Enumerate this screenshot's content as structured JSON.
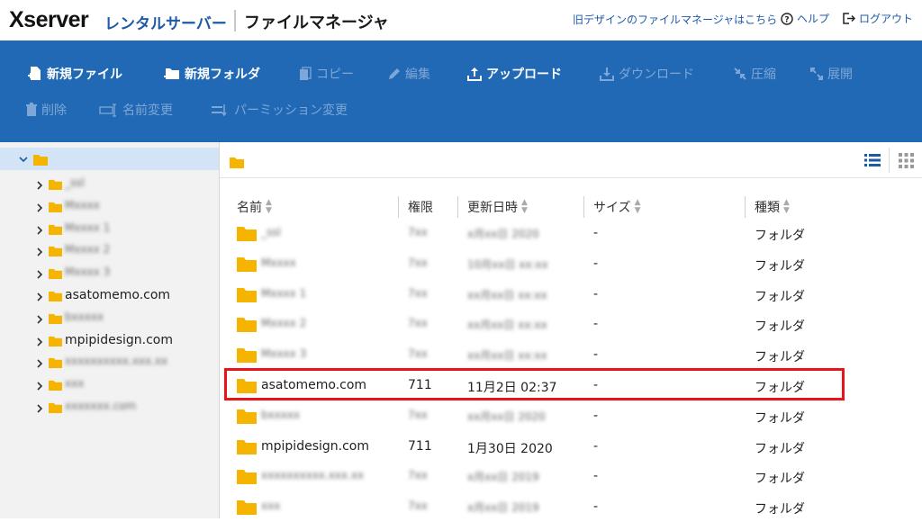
{
  "header": {
    "logo_main": "Xserver",
    "logo_sub": "レンタルサーバー",
    "title": "ファイルマネージャ",
    "old_design_link": "旧デザインのファイルマネージャはこちら",
    "help_label": "ヘルプ",
    "logout_label": "ログアウト"
  },
  "toolbar": {
    "new_file": "新規ファイル",
    "new_folder": "新規フォルダ",
    "copy": "コピー",
    "edit": "編集",
    "upload": "アップロード",
    "download": "ダウンロード",
    "compress": "圧縮",
    "extract": "展開",
    "delete": "削除",
    "rename": "名前変更",
    "permission": "パーミッション変更"
  },
  "sidebar": {
    "items": [
      {
        "label": "_ssl",
        "blurred": true
      },
      {
        "label": "Mxxxx",
        "blurred": true
      },
      {
        "label": "Mxxxx 1",
        "blurred": true
      },
      {
        "label": "Mxxxx 2",
        "blurred": true
      },
      {
        "label": "Mxxxx 3",
        "blurred": true
      },
      {
        "label": "asatomemo.com",
        "blurred": false
      },
      {
        "label": "bxxxxx",
        "blurred": true
      },
      {
        "label": "mpipidesign.com",
        "blurred": false
      },
      {
        "label": "xxxxxxxxxx.xxx.xx",
        "blurred": true
      },
      {
        "label": "xxx",
        "blurred": true
      },
      {
        "label": "xxxxxxx.com",
        "blurred": true
      }
    ]
  },
  "table": {
    "headers": {
      "name": "名前",
      "perm": "権限",
      "date": "更新日時",
      "size": "サイズ",
      "type": "種類"
    },
    "rows": [
      {
        "name": "_ssl",
        "perm": "7xx",
        "date": "x月xx日 2020",
        "size": "-",
        "type": "フォルダ",
        "blurred": true
      },
      {
        "name": "Mxxxx",
        "perm": "7xx",
        "date": "10月xx日 xx:xx",
        "size": "-",
        "type": "フォルダ",
        "blurred": true
      },
      {
        "name": "Mxxxx 1",
        "perm": "7xx",
        "date": "xx月xx日 xx:xx",
        "size": "-",
        "type": "フォルダ",
        "blurred": true
      },
      {
        "name": "Mxxxx 2",
        "perm": "7xx",
        "date": "xx月xx日 xx:xx",
        "size": "-",
        "type": "フォルダ",
        "blurred": true
      },
      {
        "name": "Mxxxx 3",
        "perm": "7xx",
        "date": "xx月xx日 xx:xx",
        "size": "-",
        "type": "フォルダ",
        "blurred": true
      },
      {
        "name": "asatomemo.com",
        "perm": "711",
        "date": "11月2日 02:37",
        "size": "-",
        "type": "フォルダ",
        "blurred": false
      },
      {
        "name": "bxxxxx",
        "perm": "7xx",
        "date": "xx月xx日 2020",
        "size": "-",
        "type": "フォルダ",
        "blurred": true
      },
      {
        "name": "mpipidesign.com",
        "perm": "711",
        "date": "1月30日 2020",
        "size": "-",
        "type": "フォルダ",
        "blurred": false
      },
      {
        "name": "xxxxxxxxxx.xxx.xx",
        "perm": "7xx",
        "date": "x月xx日 2019",
        "size": "-",
        "type": "フォルダ",
        "blurred": true
      },
      {
        "name": "xxx",
        "perm": "7xx",
        "date": "x月xx日 2019",
        "size": "-",
        "type": "フォルダ",
        "blurred": true
      }
    ]
  },
  "colors": {
    "toolbar_bg": "#2169b4",
    "highlight": "#e8141a",
    "folder": "#f5b400",
    "tree_selected": "#d3e4f6"
  }
}
